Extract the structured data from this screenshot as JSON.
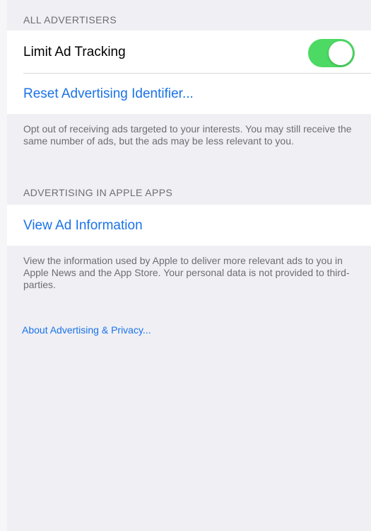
{
  "sections": {
    "all_advertisers": {
      "header": "ALL ADVERTISERS",
      "limit_ad_tracking_label": "Limit Ad Tracking",
      "limit_ad_tracking_on": true,
      "reset_link": "Reset Advertising Identifier...",
      "footer": "Opt out of receiving ads targeted to your interests. You may still receive the same number of ads, but the ads may be less relevant to you."
    },
    "apple_apps": {
      "header": "ADVERTISING IN APPLE APPS",
      "view_ad_info_link": "View Ad Information",
      "footer": "View the information used by Apple to deliver more relevant ads to you in Apple News and the App Store. Your personal data is not provided to third-parties."
    }
  },
  "about_link": "About Advertising & Privacy...",
  "colors": {
    "background": "#efeff4",
    "toggle_on": "#4cd964",
    "link": "#1a73e8",
    "secondary_text": "#6d6d72"
  }
}
